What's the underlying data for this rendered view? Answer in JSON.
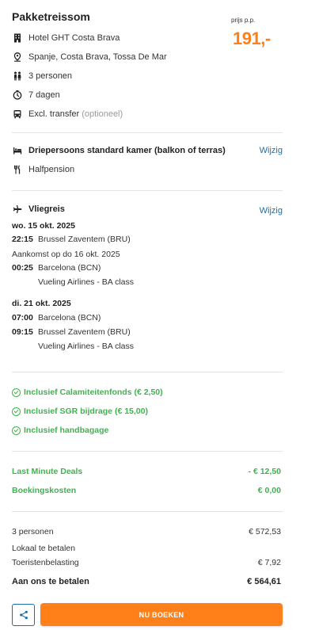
{
  "header": {
    "title": "Pakketreissom",
    "price_label": "prijs p.p.",
    "price": "191,-"
  },
  "summary": {
    "hotel": "Hotel GHT Costa Brava",
    "location": "Spanje, Costa Brava, Tossa De Mar",
    "persons": "3 personen",
    "duration": "7 dagen",
    "transfer": "Excl. transfer",
    "transfer_note": "(optioneel)"
  },
  "room": {
    "room_type": "Driepersoons standard kamer (balkon of terras)",
    "board": "Halfpension",
    "change_label": "Wijzig"
  },
  "flight": {
    "heading": "Vliegreis",
    "change_label": "Wijzig",
    "outbound": {
      "date": "wo. 15 okt. 2025",
      "dep_time": "22:15",
      "dep_airport": "Brussel Zaventem (BRU)",
      "arrival_note": "Aankomst op do 16 okt. 2025",
      "arr_time": "00:25",
      "arr_airport": "Barcelona (BCN)",
      "airline": "Vueling Airlines - BA class"
    },
    "return": {
      "date": "di. 21 okt. 2025",
      "dep_time": "07:00",
      "dep_airport": "Barcelona (BCN)",
      "arr_time": "09:15",
      "arr_airport": "Brussel Zaventem (BRU)",
      "airline": "Vueling Airlines - BA class"
    }
  },
  "inclusions": [
    "Inclusief Calamiteitenfonds (€ 2,50)",
    "Inclusief SGR bijdrage (€ 15,00)",
    "Inclusief handbagage"
  ],
  "discounts": {
    "deals_label": "Last Minute Deals",
    "deals_value": "- € 12,50",
    "booking_label": "Boekingskosten",
    "booking_value": "€ 0,00"
  },
  "totals": {
    "persons_label": "3 personen",
    "persons_value": "€ 572,53",
    "local_label": "Lokaal te betalen",
    "tax_label": "Toeristenbelasting",
    "tax_value": "€ 7,92",
    "pay_label": "Aan ons te betalen",
    "pay_value": "€ 564,61"
  },
  "actions": {
    "book_label": "NU BOEKEN"
  },
  "colors": {
    "accent": "#ff7f18",
    "link": "#1f6fa6",
    "success": "#3fb34f"
  }
}
